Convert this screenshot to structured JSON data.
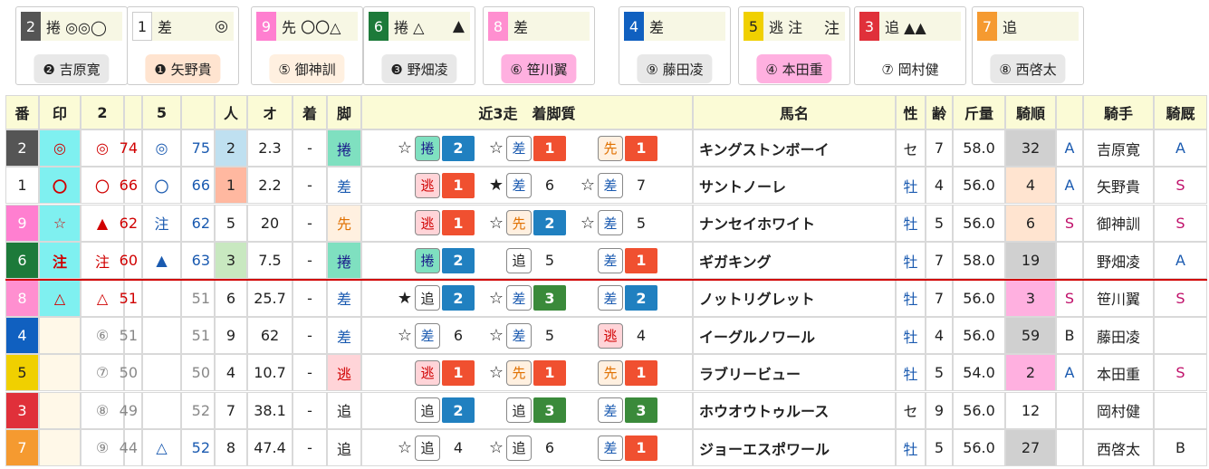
{
  "colors": {
    "waku": {
      "1": "#ffffff",
      "2": "#555555",
      "3": "#e0303a",
      "4": "#1060c0",
      "5": "#f0d000",
      "6": "#1d7a3a",
      "7": "#f59a30",
      "8": "#ff8fd0",
      "9": "#ff7fd0"
    },
    "waku_text": {
      "1": "#222222",
      "2": "#ffffff",
      "3": "#ffffff",
      "4": "#ffffff",
      "5": "#222222",
      "6": "#ffffff",
      "7": "#ffffff",
      "8": "#ffffff",
      "9": "#ffffff"
    },
    "style_bg": {
      "捲": "#7fe0c0",
      "差": "#ffffff",
      "先": "#fff0e0",
      "逃": "#ffd4d8",
      "追": "#ffffff"
    },
    "style_fg": {
      "捲": "#1a1a8a",
      "差": "#1a5ab0",
      "先": "#e07000",
      "逃": "#d00000",
      "追": "#222222"
    },
    "badge_bg": {
      "捲": "#7fe0c0",
      "差": "#ffffff",
      "先": "#fff0e0",
      "逃": "#ffd4d8",
      "追": "#ffffff"
    },
    "pos_bg": {
      "1": "#f05030",
      "2": "#2080c0",
      "3": "#3a8a3a"
    },
    "ninki_bg": {
      "1": "#ffb8a0",
      "2": "#bfe0f0",
      "3": "#c8e8c0"
    },
    "kijun_bg": {
      "1": "#ffb0e0",
      "2": "#ffb0e0",
      "3": "#ffb0e0",
      "4": "#ffe4d0",
      "6": "#ffe4d0",
      "12": "#ffffff",
      "19": "#d0d0d0",
      "27": "#d0d0d0",
      "32": "#d0d0d0",
      "59": "#d0d0d0"
    }
  },
  "cards": [
    {
      "num": "2",
      "marks": "捲 ◎◎◯",
      "tail": "",
      "jockey": "❷ 吉原寛",
      "jockey_bg": "#e8e8e8"
    },
    {
      "num": "1",
      "marks": "差",
      "tail": "◎",
      "jockey": "❶ 矢野貴",
      "jockey_bg": "#ffe4d0"
    },
    {
      "num": "9",
      "marks": "先 〇〇△",
      "tail": "",
      "jockey": "⑤ 御神訓",
      "jockey_bg": "#fff0e0"
    },
    {
      "num": "6",
      "marks": "捲 △",
      "tail": "▲",
      "jockey": "❸ 野畑凌",
      "jockey_bg": "#e8e8e8"
    },
    {
      "num": "8",
      "marks": "差",
      "tail": "",
      "jockey": "⑥ 笹川翼",
      "jockey_bg": "#ffb0e0"
    },
    {
      "num": "4",
      "marks": "差",
      "tail": "",
      "jockey": "⑨ 藤田凌",
      "jockey_bg": "#e8e8e8"
    },
    {
      "num": "5",
      "marks": "逃 注",
      "tail": "注",
      "jockey": "④ 本田重",
      "jockey_bg": "#ffb0e0"
    },
    {
      "num": "3",
      "marks": "追 ▲▲",
      "tail": "",
      "jockey": "⑦ 岡村健",
      "jockey_bg": "#ffffff"
    },
    {
      "num": "7",
      "marks": "追",
      "tail": "",
      "jockey": "⑧ 西啓太",
      "jockey_bg": "#e8e8e8"
    }
  ],
  "headers": [
    "番",
    "印",
    "2",
    "",
    "5",
    "",
    "人",
    "オ",
    "着",
    "脚",
    "近3走　着脚質",
    "馬名",
    "性",
    "齢",
    "斤量",
    "騎順",
    "",
    "騎手",
    "騎厩"
  ],
  "rows": [
    {
      "ban": "2",
      "mark": "◎",
      "m2": "◎",
      "s2": "74",
      "m5": "◎",
      "s5": "75",
      "ninki": "2",
      "odds": "2.3",
      "chaku": "-",
      "style": "捲",
      "past": [
        {
          "star": "☆",
          "style": "捲",
          "pos": "2"
        },
        {
          "star": "☆",
          "style": "差",
          "pos": "1"
        },
        {
          "star": "",
          "style": "先",
          "pos": "1"
        }
      ],
      "name": "キングストンボーイ",
      "sex": "セ",
      "age": "7",
      "kin": "58.0",
      "kijun": "32",
      "rank": "A",
      "jockey": "吉原寛",
      "kyu": "A"
    },
    {
      "ban": "1",
      "mark": "〇",
      "m2": "〇",
      "s2": "66",
      "m5": "〇",
      "s5": "66",
      "ninki": "1",
      "odds": "2.2",
      "chaku": "-",
      "style": "差",
      "past": [
        {
          "star": "",
          "style": "逃",
          "pos": "1"
        },
        {
          "star": "★",
          "style": "差",
          "pos": "6"
        },
        {
          "star": "☆",
          "style": "差",
          "pos": "7"
        }
      ],
      "name": "サントノーレ",
      "sex": "牡",
      "age": "4",
      "kin": "56.0",
      "kijun": "4",
      "rank": "A",
      "jockey": "矢野貴",
      "kyu": "S"
    },
    {
      "ban": "9",
      "mark": "☆",
      "m2": "▲",
      "s2": "62",
      "m5": "注",
      "s5": "62",
      "ninki": "5",
      "odds": "20",
      "chaku": "-",
      "style": "先",
      "past": [
        {
          "star": "",
          "style": "逃",
          "pos": "1"
        },
        {
          "star": "☆",
          "style": "先",
          "pos": "2"
        },
        {
          "star": "☆",
          "style": "差",
          "pos": "5"
        }
      ],
      "name": "ナンセイホワイト",
      "sex": "牡",
      "age": "5",
      "kin": "56.0",
      "kijun": "6",
      "rank": "S",
      "jockey": "御神訓",
      "kyu": "S"
    },
    {
      "ban": "6",
      "mark": "注",
      "m2": "注",
      "s2": "60",
      "m5": "▲",
      "s5": "63",
      "ninki": "3",
      "odds": "7.5",
      "chaku": "-",
      "style": "捲",
      "past": [
        {
          "star": "",
          "style": "捲",
          "pos": "2"
        },
        {
          "star": "",
          "style": "追",
          "pos": "5"
        },
        {
          "star": "",
          "style": "差",
          "pos": "1"
        }
      ],
      "name": "ギガキング",
      "sex": "牡",
      "age": "7",
      "kin": "58.0",
      "kijun": "19",
      "rank": "",
      "jockey": "野畑凌",
      "kyu": "A"
    },
    {
      "ban": "8",
      "mark": "△",
      "m2": "△",
      "s2": "51",
      "m5": "",
      "s5": "51",
      "ninki": "6",
      "odds": "25.7",
      "chaku": "-",
      "style": "差",
      "past": [
        {
          "star": "★",
          "style": "追",
          "pos": "2"
        },
        {
          "star": "☆",
          "style": "差",
          "pos": "3"
        },
        {
          "star": "",
          "style": "差",
          "pos": "2"
        }
      ],
      "name": "ノットリグレット",
      "sex": "牡",
      "age": "7",
      "kin": "56.0",
      "kijun": "3",
      "rank": "S",
      "jockey": "笹川翼",
      "kyu": "S"
    },
    {
      "ban": "4",
      "mark": "",
      "m2": "⑥",
      "s2": "51",
      "m5": "",
      "s5": "51",
      "ninki": "9",
      "odds": "62",
      "chaku": "-",
      "style": "差",
      "past": [
        {
          "star": "☆",
          "style": "差",
          "pos": "6"
        },
        {
          "star": "☆",
          "style": "差",
          "pos": "5"
        },
        {
          "star": "",
          "style": "逃",
          "pos": "4"
        }
      ],
      "name": "イーグルノワール",
      "sex": "牡",
      "age": "4",
      "kin": "56.0",
      "kijun": "59",
      "rank": "B",
      "jockey": "藤田凌",
      "kyu": ""
    },
    {
      "ban": "5",
      "mark": "",
      "m2": "⑦",
      "s2": "50",
      "m5": "",
      "s5": "50",
      "ninki": "4",
      "odds": "10.7",
      "chaku": "-",
      "style": "逃",
      "past": [
        {
          "star": "",
          "style": "逃",
          "pos": "1"
        },
        {
          "star": "☆",
          "style": "先",
          "pos": "1"
        },
        {
          "star": "",
          "style": "先",
          "pos": "1"
        }
      ],
      "name": "ラブリービュー",
      "sex": "牡",
      "age": "5",
      "kin": "54.0",
      "kijun": "2",
      "rank": "A",
      "jockey": "本田重",
      "kyu": "S"
    },
    {
      "ban": "3",
      "mark": "",
      "m2": "⑧",
      "s2": "49",
      "m5": "",
      "s5": "52",
      "ninki": "7",
      "odds": "38.1",
      "chaku": "-",
      "style": "追",
      "past": [
        {
          "star": "",
          "style": "追",
          "pos": "2"
        },
        {
          "star": "",
          "style": "追",
          "pos": "3"
        },
        {
          "star": "",
          "style": "差",
          "pos": "3"
        }
      ],
      "name": "ホウオウトゥルース",
      "sex": "セ",
      "age": "9",
      "kin": "56.0",
      "kijun": "12",
      "rank": "",
      "jockey": "岡村健",
      "kyu": ""
    },
    {
      "ban": "7",
      "mark": "",
      "m2": "⑨",
      "s2": "44",
      "m5": "△",
      "s5": "52",
      "ninki": "8",
      "odds": "47.4",
      "chaku": "-",
      "style": "追",
      "past": [
        {
          "star": "☆",
          "style": "追",
          "pos": "4"
        },
        {
          "star": "☆",
          "style": "追",
          "pos": "6"
        },
        {
          "star": "",
          "style": "差",
          "pos": "1"
        }
      ],
      "name": "ジョーエスポワール",
      "sex": "牡",
      "age": "5",
      "kin": "56.0",
      "kijun": "27",
      "rank": "",
      "jockey": "西啓太",
      "kyu": "B"
    }
  ]
}
